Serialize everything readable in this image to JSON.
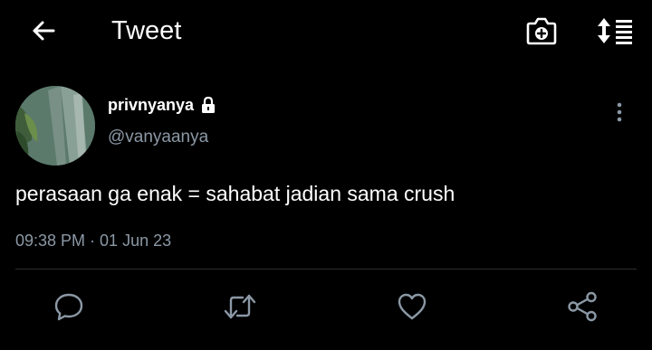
{
  "header": {
    "title": "Tweet",
    "icons": {
      "back": "arrow-left-icon",
      "camera": "camera-plus-icon",
      "sort": "sort-list-icon"
    }
  },
  "tweet": {
    "display_name": "privnyanya",
    "handle": "@vanyaanya",
    "text": "perasaan ga enak = sahabat jadian sama crush",
    "timestamp": "09:38 PM · 01 Jun 23",
    "protected": true
  },
  "actions": [
    "reply",
    "retweet",
    "like",
    "share"
  ],
  "colors": {
    "background": "#000000",
    "text": "#ffffff",
    "secondary": "#8b98a5",
    "divider": "#2a2d31"
  }
}
